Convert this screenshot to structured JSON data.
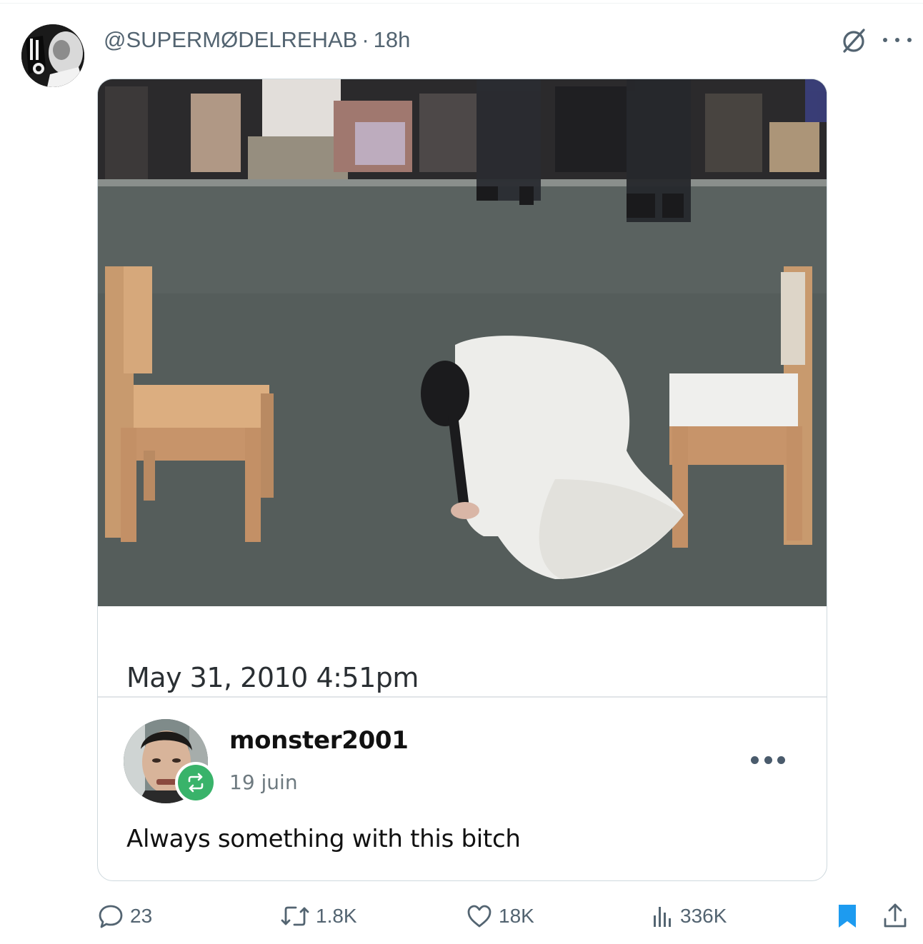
{
  "tweet": {
    "handle": "@SUPERMØDELREHAB",
    "separator": "·",
    "time": "18h"
  },
  "embedded_post": {
    "date": "May 31, 2010 4:51pm",
    "username": "monster2001",
    "post_date": "19 juin",
    "text": "Always something with this bitch"
  },
  "actions": {
    "replies": "23",
    "reposts": "1.8K",
    "likes": "18K",
    "views": "336K"
  },
  "colors": {
    "muted": "#536471",
    "bookmark_active": "#1d9bf0",
    "reblog_green": "#39b36a"
  },
  "icons": [
    "grok-icon",
    "more-icon",
    "reply-icon",
    "repost-icon",
    "like-icon",
    "views-icon",
    "bookmark-icon",
    "share-icon"
  ]
}
